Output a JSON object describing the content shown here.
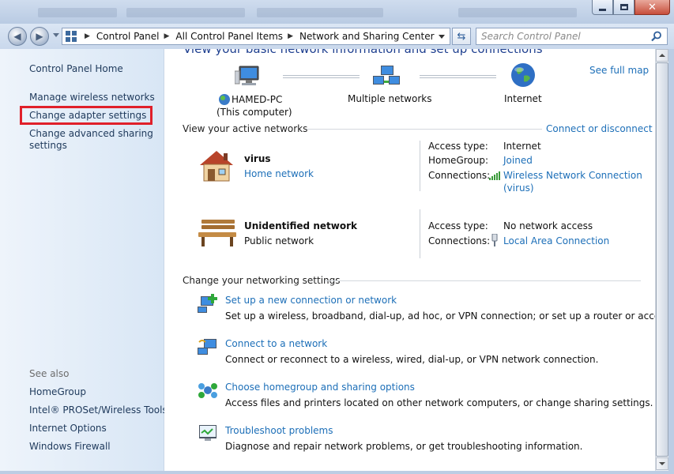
{
  "window": {
    "controls": {
      "minimize": "minimize-icon",
      "maximize": "maximize-icon",
      "close": "close-icon"
    }
  },
  "address": {
    "crumbs": [
      "Control Panel",
      "All Control Panel Items",
      "Network and Sharing Center"
    ],
    "search_placeholder": "Search Control Panel"
  },
  "sidebar": {
    "home": "Control Panel Home",
    "items": [
      {
        "label": "Manage wireless networks"
      },
      {
        "label": "Change adapter settings",
        "highlighted": true
      },
      {
        "label": "Change advanced sharing settings"
      }
    ],
    "see_also_header": "See also",
    "see_also": [
      "HomeGroup",
      "Intel® PROSet/Wireless Tools",
      "Internet Options",
      "Windows Firewall"
    ]
  },
  "main": {
    "title": "View your basic network information and set up connections",
    "see_full_map": "See full map",
    "map": {
      "computer_name": "HAMED-PC",
      "computer_sub": "(This computer)",
      "middle": "Multiple networks",
      "right": "Internet"
    },
    "active_header": "View your active networks",
    "connect_link": "Connect or disconnect",
    "networks": [
      {
        "name": "virus",
        "type": "Home network",
        "type_is_link": true,
        "access_label": "Access type:",
        "access": "Internet",
        "homegroup_label": "HomeGroup:",
        "homegroup": "Joined",
        "connections_label": "Connections:",
        "connection_line1": "Wireless Network Connection",
        "connection_line2": "(virus)"
      },
      {
        "name": "Unidentified network",
        "type": "Public network",
        "access_label": "Access type:",
        "access": "No network access",
        "connections_label": "Connections:",
        "connection_line1": "Local Area Connection"
      }
    ],
    "settings_header": "Change your networking settings",
    "tasks": [
      {
        "title": "Set up a new connection or network",
        "desc": "Set up a wireless, broadband, dial-up, ad hoc, or VPN connection; or set up a router or access point."
      },
      {
        "title": "Connect to a network",
        "desc": "Connect or reconnect to a wireless, wired, dial-up, or VPN network connection."
      },
      {
        "title": "Choose homegroup and sharing options",
        "desc": "Access files and printers located on other network computers, or change sharing settings."
      },
      {
        "title": "Troubleshoot problems",
        "desc": "Diagnose and repair network problems, or get troubleshooting information."
      }
    ]
  },
  "colors": {
    "link": "#1d6fb8",
    "highlight": "#e0202a",
    "sidebar_link": "#1e395b"
  }
}
